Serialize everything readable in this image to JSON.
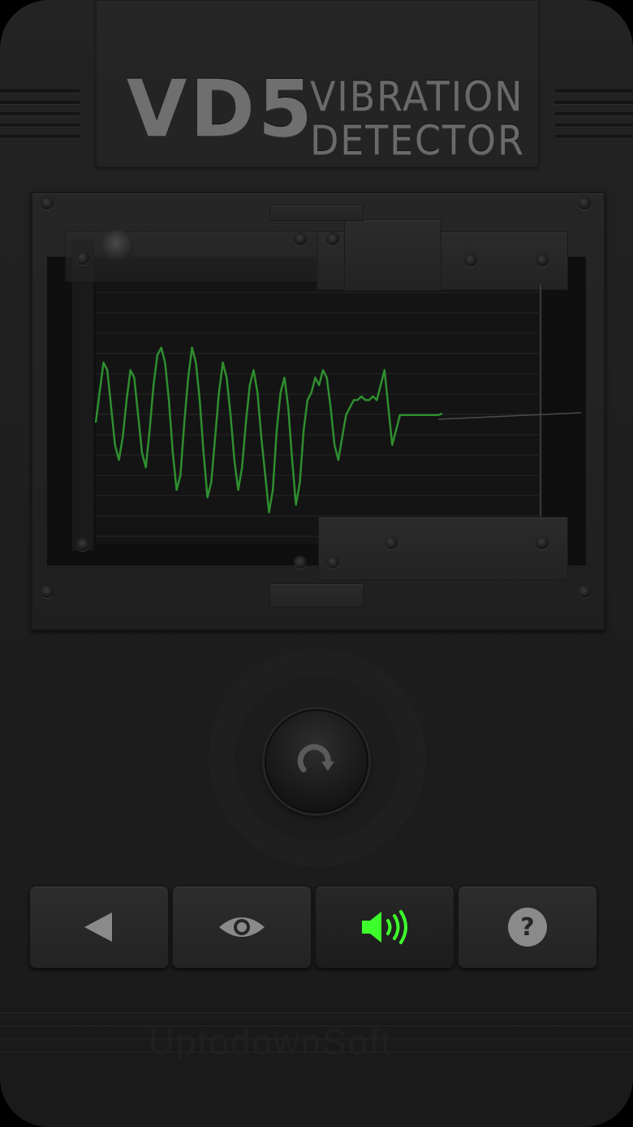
{
  "app": {
    "model": "VD5",
    "subtitle_line1": "VIBRATION",
    "subtitle_line2": "DETECTOR",
    "watermark": "UptodownSoft"
  },
  "colors": {
    "waveform": "#2f8f2f",
    "active_icon": "#3dff2a",
    "icon": "#8a8a8a",
    "body": "#1f1f1f"
  },
  "controls": {
    "rotate_icon": "rotate-clockwise-icon"
  },
  "toolbar": {
    "buttons": [
      {
        "icon": "back-triangle-icon",
        "active": false
      },
      {
        "icon": "eye-icon",
        "active": false
      },
      {
        "icon": "speaker-icon",
        "active": true
      },
      {
        "icon": "help-icon",
        "active": false
      }
    ]
  },
  "chart_data": {
    "type": "line",
    "y_values": [
      0.0,
      0.4,
      0.8,
      0.7,
      0.2,
      -0.3,
      -0.5,
      -0.2,
      0.3,
      0.7,
      0.6,
      0.1,
      -0.4,
      -0.6,
      -0.1,
      0.5,
      0.9,
      1.0,
      0.8,
      0.3,
      -0.4,
      -0.9,
      -0.7,
      0.0,
      0.6,
      1.0,
      0.8,
      0.3,
      -0.4,
      -1.0,
      -0.8,
      -0.2,
      0.4,
      0.8,
      0.6,
      0.1,
      -0.5,
      -0.9,
      -0.6,
      0.0,
      0.5,
      0.7,
      0.4,
      -0.2,
      -0.7,
      -1.2,
      -0.9,
      -0.1,
      0.4,
      0.6,
      0.2,
      -0.5,
      -1.1,
      -0.8,
      -0.1,
      0.3,
      0.4,
      0.6,
      0.5,
      0.7,
      0.6,
      0.2,
      -0.3,
      -0.5,
      -0.2,
      0.1,
      0.2,
      0.3,
      0.3,
      0.35,
      0.3,
      0.3,
      0.35,
      0.3,
      0.5,
      0.7,
      0.2,
      -0.3,
      -0.1,
      0.1,
      0.1,
      0.1,
      0.1,
      0.1,
      0.1,
      0.1,
      0.1,
      0.1,
      0.1,
      0.1,
      0.12
    ],
    "grid": true,
    "ylim": [
      -1.5,
      1.5
    ]
  }
}
